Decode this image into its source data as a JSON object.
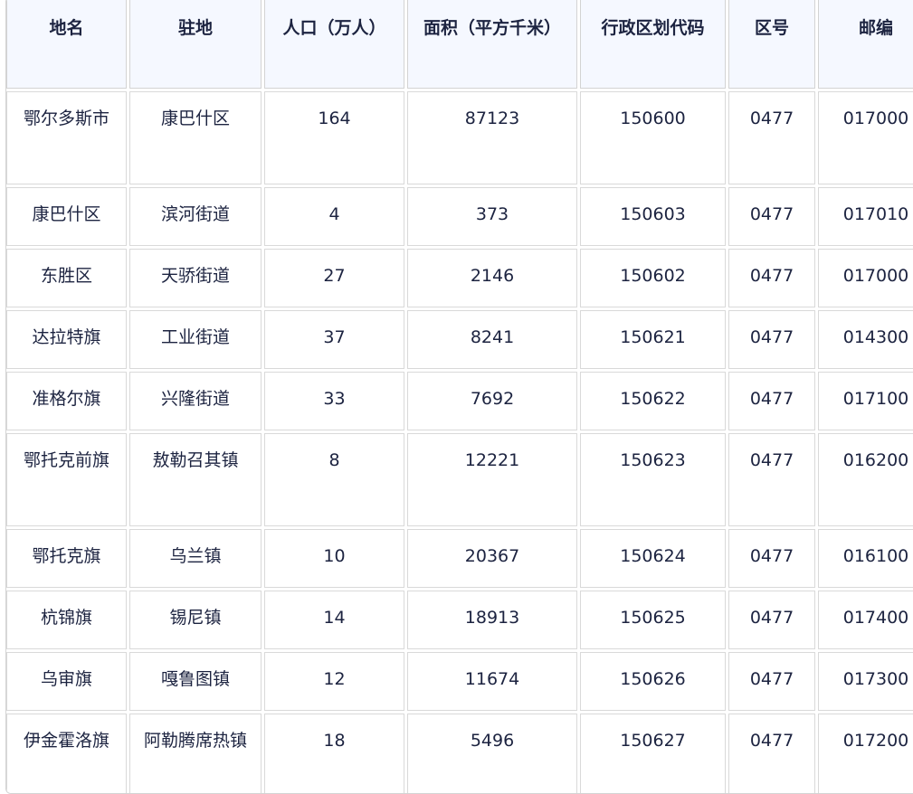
{
  "table": {
    "headers": [
      "地名",
      "驻地",
      "人口（万人）",
      "面积（平方千米）",
      "行政区划代码",
      "区号",
      "邮编"
    ],
    "rows": [
      [
        "鄂尔多斯市",
        "康巴什区",
        "164",
        "87123",
        "150600",
        "0477",
        "017000"
      ],
      [
        "康巴什区",
        "滨河街道",
        "4",
        "373",
        "150603",
        "0477",
        "017010"
      ],
      [
        "东胜区",
        "天骄街道",
        "27",
        "2146",
        "150602",
        "0477",
        "017000"
      ],
      [
        "达拉特旗",
        "工业街道",
        "37",
        "8241",
        "150621",
        "0477",
        "014300"
      ],
      [
        "准格尔旗",
        "兴隆街道",
        "33",
        "7692",
        "150622",
        "0477",
        "017100"
      ],
      [
        "鄂托克前旗",
        "敖勒召其镇",
        "8",
        "12221",
        "150623",
        "0477",
        "016200"
      ],
      [
        "鄂托克旗",
        "乌兰镇",
        "10",
        "20367",
        "150624",
        "0477",
        "016100"
      ],
      [
        "杭锦旗",
        "锡尼镇",
        "14",
        "18913",
        "150625",
        "0477",
        "017400"
      ],
      [
        "乌审旗",
        "嘎鲁图镇",
        "12",
        "11674",
        "150626",
        "0477",
        "017300"
      ],
      [
        "伊金霍洛旗",
        "阿勒腾席热镇",
        "18",
        "5496",
        "150627",
        "0477",
        "017200"
      ]
    ]
  },
  "colors": {
    "header_bg": "#f5f8ff",
    "text": "#1c2340",
    "border": "#d9d9d9"
  }
}
